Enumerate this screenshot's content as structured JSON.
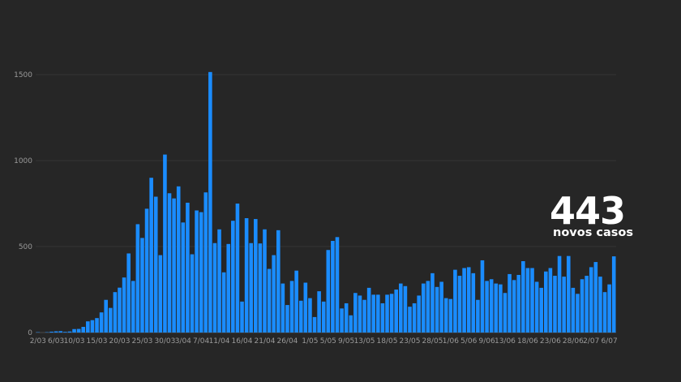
{
  "annotation": {
    "number": "443",
    "label": "novos casos"
  },
  "chart_data": {
    "type": "bar",
    "color": "#1a8cff",
    "background": "#262626",
    "grid": true,
    "ylim": [
      0,
      1500
    ],
    "yticks": [
      0,
      500,
      1000,
      1500
    ],
    "x_tick_labels": [
      "2/03",
      "6/03",
      "10/03",
      "15/03",
      "20/03",
      "25/03",
      "30/03",
      "3/04",
      "7/04",
      "11/04",
      "16/04",
      "21/04",
      "26/04",
      "1/05",
      "5/05",
      "9/05",
      "13/05",
      "18/05",
      "23/05",
      "28/05",
      "1/06",
      "5/06",
      "9/06",
      "13/06",
      "18/06",
      "23/06",
      "28/06",
      "2/07",
      "6/07"
    ],
    "x_tick_indices": [
      0,
      4,
      8,
      13,
      18,
      23,
      28,
      32,
      36,
      40,
      45,
      50,
      55,
      60,
      64,
      68,
      72,
      77,
      82,
      87,
      91,
      95,
      99,
      103,
      108,
      113,
      118,
      122,
      126
    ],
    "values": [
      2,
      0,
      2,
      5,
      7,
      8,
      4,
      6,
      20,
      21,
      33,
      65,
      72,
      84,
      117,
      190,
      143,
      235,
      261,
      320,
      460,
      300,
      630,
      550,
      720,
      900,
      790,
      450,
      1035,
      810,
      780,
      850,
      640,
      755,
      455,
      710,
      700,
      815,
      1515,
      520,
      600,
      350,
      515,
      650,
      750,
      180,
      665,
      520,
      660,
      518,
      600,
      370,
      450,
      595,
      285,
      160,
      300,
      360,
      185,
      290,
      200,
      90,
      240,
      180,
      480,
      533,
      555,
      140,
      170,
      100,
      230,
      215,
      190,
      260,
      220,
      220,
      170,
      220,
      225,
      250,
      285,
      270,
      150,
      170,
      215,
      285,
      300,
      345,
      265,
      295,
      200,
      195,
      365,
      330,
      375,
      380,
      345,
      190,
      420,
      300,
      310,
      285,
      280,
      230,
      340,
      305,
      335,
      415,
      375,
      375,
      295,
      260,
      355,
      375,
      330,
      445,
      325,
      445,
      260,
      225,
      310,
      330,
      380,
      410,
      325,
      235,
      280,
      443
    ]
  }
}
